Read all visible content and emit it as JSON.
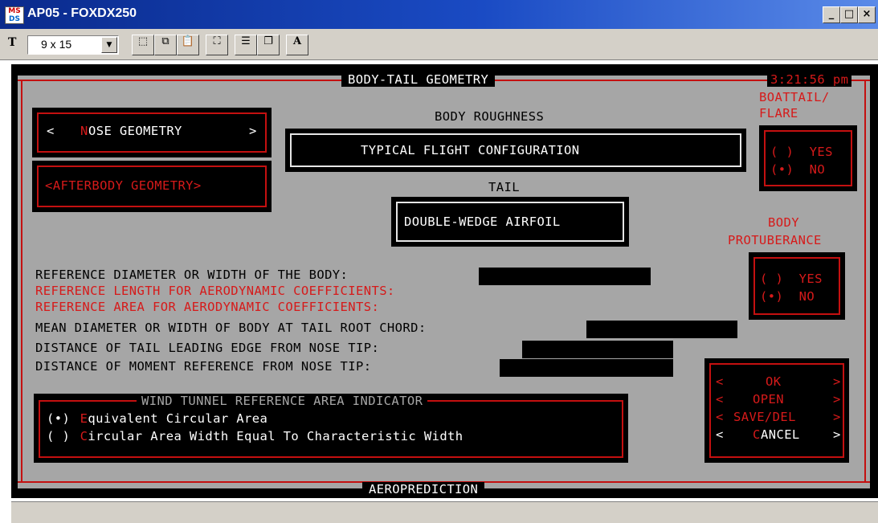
{
  "window": {
    "title": "AP05 - FOXDX250",
    "icon_text_top": "MS",
    "icon_text_bottom": "DS",
    "minimize": "_",
    "maximize": "□",
    "close": "×"
  },
  "toolbar": {
    "font_size": "9 x 15",
    "font_icon": "T",
    "bold_a": "A"
  },
  "screen": {
    "title": "BODY-TAIL GEOMETRY",
    "clock": "3:21:56 pm",
    "footer": "AEROPREDICTION",
    "nose_button": {
      "lt": "<",
      "hot": "N",
      "rest": "OSE GEOMETRY",
      "gt": ">"
    },
    "afterbody_button": "<AFTERBODY GEOMETRY>",
    "roughness_label": "BODY ROUGHNESS",
    "roughness_value": "TYPICAL FLIGHT CONFIGURATION",
    "tail_label": "TAIL",
    "tail_value": "DOUBLE-WEDGE AIRFOIL",
    "boattail_label_1": "BOATTAIL/",
    "boattail_label_2": "FLARE",
    "boattail_yes": "( )  YES",
    "boattail_no": "(•)  NO",
    "protuberance_label_1": "BODY",
    "protuberance_label_2": "PROTUBERANCE",
    "protuberance_yes": "( )  YES",
    "protuberance_no": "(•)  NO",
    "fields": [
      "REFERENCE DIAMETER OR WIDTH OF THE BODY:",
      "REFERENCE LENGTH FOR AERODYNAMIC COEFFICIENTS:",
      "REFERENCE AREA FOR AERODYNAMIC COEFFICIENTS:",
      "MEAN DIAMETER OR WIDTH OF BODY AT TAIL ROOT CHORD:",
      "DISTANCE OF TAIL LEADING EDGE FROM NOSE TIP:",
      "DISTANCE OF MOMENT REFERENCE FROM NOSE TIP:"
    ],
    "wind_tunnel": {
      "title": "WIND TUNNEL REFERENCE AREA INDICATOR",
      "opt1_radio": "(•)",
      "opt1_hot": "E",
      "opt1_rest": "quivalent Circular Area",
      "opt2_radio": "( )",
      "opt2_hot": "C",
      "opt2_rest": "ircular Area Width Equal To Characteristic Width"
    },
    "actions": {
      "ok": "OK",
      "open": "OPEN",
      "save": "SAVE/DEL",
      "cancel_hot": "C",
      "cancel_rest": "ANCEL",
      "lt": "<",
      "gt": ">"
    }
  },
  "colors": {
    "panel": "#a6a6a6",
    "accent_red": "#c41010",
    "titlebar": "#0a2a8c"
  }
}
